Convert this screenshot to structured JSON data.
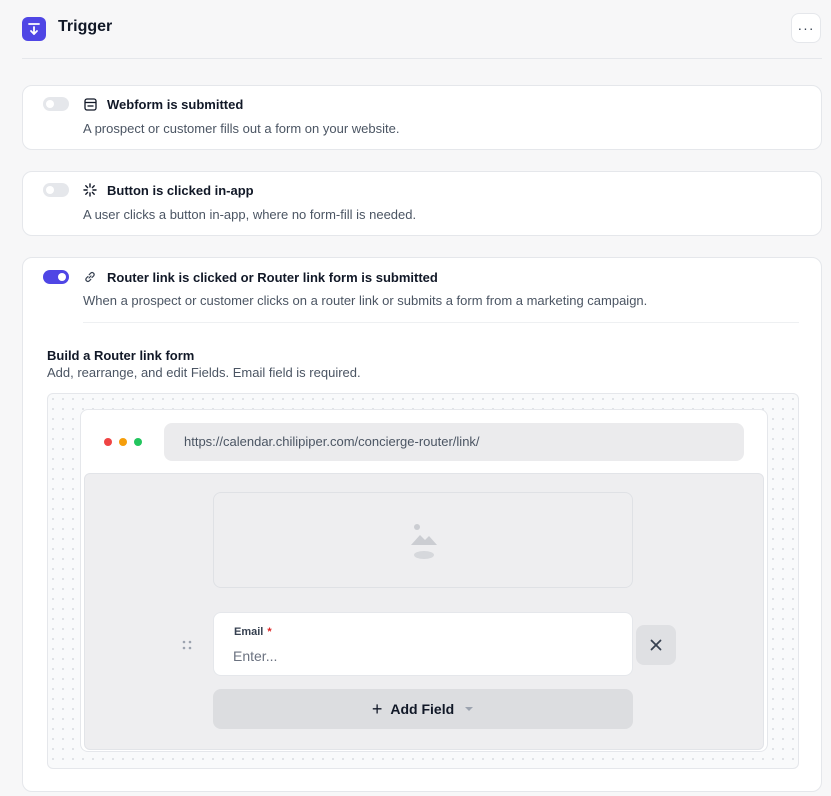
{
  "header": {
    "title": "Trigger",
    "icon": "arrow-down-to-line-icon",
    "more_label": "···"
  },
  "colors": {
    "accent": "#4f46e5",
    "toggle_off": "#e5e7eb",
    "dot_red": "#ef4444",
    "dot_yellow": "#f59e0b",
    "dot_green": "#22c55e",
    "required": "#dc2626"
  },
  "options": [
    {
      "title": "Webform is submitted",
      "description": "A prospect or customer fills out a form on your website.",
      "enabled": false,
      "icon": "form-window-icon"
    },
    {
      "title": "Button is clicked in-app",
      "description": "A user clicks a button in-app, where no form-fill is needed.",
      "enabled": false,
      "icon": "click-burst-icon"
    },
    {
      "title": "Router link is clicked or Router link form is submitted",
      "description": "When a prospect or customer clicks on a router link or submits a form from a marketing campaign.",
      "enabled": true,
      "icon": "link-icon"
    }
  ],
  "builder": {
    "title": "Build a Router link form",
    "description": "Add, rearrange, and edit Fields. Email field is required.",
    "url": "https://calendar.chilipiper.com/concierge-router/link/",
    "image_icon": "image-placeholder-icon",
    "fields": [
      {
        "label": "Email",
        "required_mark": "*",
        "placeholder": "Enter..."
      }
    ],
    "add_field": {
      "label": "Add Field",
      "plus": "+"
    }
  }
}
